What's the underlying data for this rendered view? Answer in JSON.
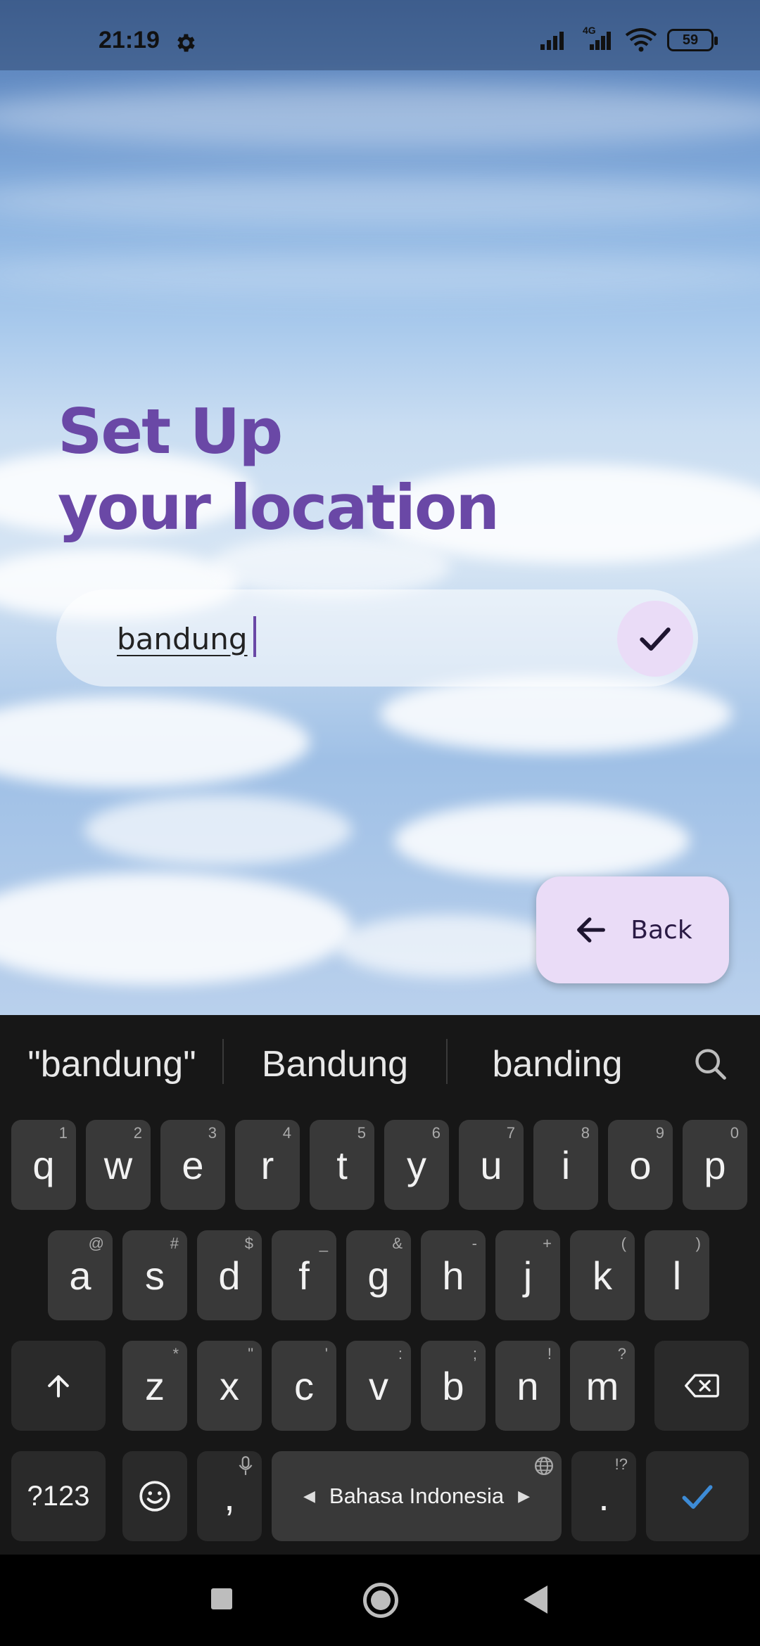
{
  "status_bar": {
    "time": "21:19",
    "network_label": "4G",
    "battery": "59"
  },
  "title": {
    "line1": "Set Up",
    "line2": "your location"
  },
  "location_input": {
    "value": "bandung"
  },
  "back_button": {
    "label": "Back"
  },
  "keyboard": {
    "suggestions": [
      "\"bandung\"",
      "Bandung",
      "banding"
    ],
    "row1": [
      {
        "key": "q",
        "hint": "1"
      },
      {
        "key": "w",
        "hint": "2"
      },
      {
        "key": "e",
        "hint": "3"
      },
      {
        "key": "r",
        "hint": "4"
      },
      {
        "key": "t",
        "hint": "5"
      },
      {
        "key": "y",
        "hint": "6"
      },
      {
        "key": "u",
        "hint": "7"
      },
      {
        "key": "i",
        "hint": "8"
      },
      {
        "key": "o",
        "hint": "9"
      },
      {
        "key": "p",
        "hint": "0"
      }
    ],
    "row2": [
      {
        "key": "a",
        "hint": "@"
      },
      {
        "key": "s",
        "hint": "#"
      },
      {
        "key": "d",
        "hint": "$"
      },
      {
        "key": "f",
        "hint": "_"
      },
      {
        "key": "g",
        "hint": "&"
      },
      {
        "key": "h",
        "hint": "-"
      },
      {
        "key": "j",
        "hint": "+"
      },
      {
        "key": "k",
        "hint": "("
      },
      {
        "key": "l",
        "hint": ")"
      }
    ],
    "row3": [
      {
        "key": "z",
        "hint": "*"
      },
      {
        "key": "x",
        "hint": "\""
      },
      {
        "key": "c",
        "hint": "'"
      },
      {
        "key": "v",
        "hint": ":"
      },
      {
        "key": "b",
        "hint": ";"
      },
      {
        "key": "n",
        "hint": "!"
      },
      {
        "key": "m",
        "hint": "?"
      }
    ],
    "symbols_key": "?123",
    "comma_key": ",",
    "space_label": "Bahasa Indonesia",
    "period_key": ".",
    "period_hint": "!?"
  },
  "colors": {
    "title": "#6a48a6",
    "button_bg": "#eadcf7",
    "keyboard_bg": "#171717",
    "key_bg": "#393939",
    "enter_check": "#3d8bd6"
  }
}
